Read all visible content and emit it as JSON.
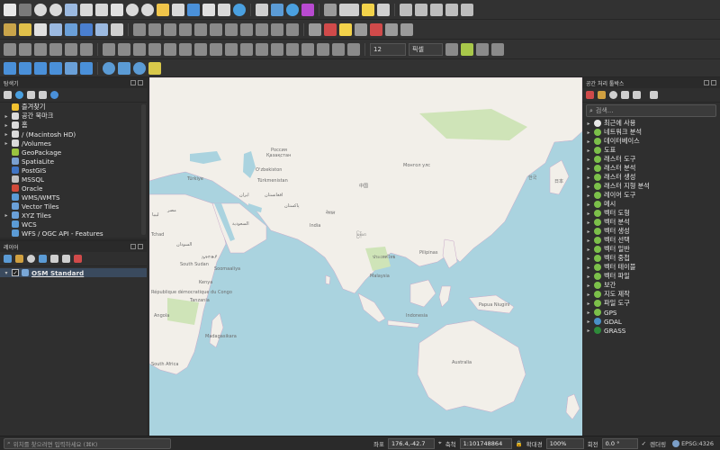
{
  "toolbar": {
    "label_size_value": "12",
    "label_unit_value": "픽셀"
  },
  "browser": {
    "title": "탐색기",
    "items": [
      {
        "label": "즐겨찾기",
        "icon": "star-icon",
        "expandable": false,
        "color": "#f2c230"
      },
      {
        "label": "공간 북마크",
        "icon": "bookmark-icon",
        "expandable": true,
        "color": "#dadada"
      },
      {
        "label": "홈",
        "icon": "folder-icon",
        "expandable": true,
        "color": "#dadada"
      },
      {
        "label": "/ (Macintosh HD)",
        "icon": "folder-icon",
        "expandable": true,
        "color": "#dadada"
      },
      {
        "label": "/Volumes",
        "icon": "folder-icon",
        "expandable": true,
        "color": "#dadada"
      },
      {
        "label": "GeoPackage",
        "icon": "geopackage-icon",
        "expandable": false,
        "color": "#9ac43f"
      },
      {
        "label": "SpatiaLite",
        "icon": "spatialite-icon",
        "expandable": false,
        "color": "#7aa0d0"
      },
      {
        "label": "PostGIS",
        "icon": "postgis-icon",
        "expandable": false,
        "color": "#3f74c4"
      },
      {
        "label": "MSSQL",
        "icon": "mssql-icon",
        "expandable": false,
        "color": "#c0c0c0"
      },
      {
        "label": "Oracle",
        "icon": "oracle-icon",
        "expandable": false,
        "color": "#d04a3a"
      },
      {
        "label": "WMS/WMTS",
        "icon": "wms-icon",
        "expandable": false,
        "color": "#5b9bd5"
      },
      {
        "label": "Vector Tiles",
        "icon": "vector-tiles-icon",
        "expandable": false,
        "color": "#6aa0d8"
      },
      {
        "label": "XYZ Tiles",
        "icon": "xyz-tiles-icon",
        "expandable": true,
        "color": "#6aa0d8"
      },
      {
        "label": "WCS",
        "icon": "wcs-icon",
        "expandable": false,
        "color": "#5b9bd5"
      },
      {
        "label": "WFS / OGC API - Features",
        "icon": "wfs-icon",
        "expandable": false,
        "color": "#5b9bd5"
      }
    ]
  },
  "layers": {
    "title": "레이어",
    "items": [
      {
        "label": "OSM Standard",
        "checked": true
      }
    ]
  },
  "processing": {
    "title": "공간 처리 툴박스",
    "search_placeholder": "검색...",
    "items": [
      {
        "label": "최근에 사용",
        "icon": "clock-icon"
      },
      {
        "label": "네트워크 분석",
        "icon": "qgis-icon"
      },
      {
        "label": "데이터베이스",
        "icon": "qgis-icon"
      },
      {
        "label": "도표",
        "icon": "qgis-icon"
      },
      {
        "label": "래스터 도구",
        "icon": "qgis-icon"
      },
      {
        "label": "래스터 분석",
        "icon": "qgis-icon"
      },
      {
        "label": "래스터 생성",
        "icon": "qgis-icon"
      },
      {
        "label": "래스터 지형 분석",
        "icon": "qgis-icon"
      },
      {
        "label": "레이어 도구",
        "icon": "qgis-icon"
      },
      {
        "label": "메시",
        "icon": "qgis-icon"
      },
      {
        "label": "벡터 도형",
        "icon": "qgis-icon"
      },
      {
        "label": "벡터 분석",
        "icon": "qgis-icon"
      },
      {
        "label": "벡터 생성",
        "icon": "qgis-icon"
      },
      {
        "label": "벡터 선택",
        "icon": "qgis-icon"
      },
      {
        "label": "벡터 일반",
        "icon": "qgis-icon"
      },
      {
        "label": "벡터 중첩",
        "icon": "qgis-icon"
      },
      {
        "label": "벡터 테이블",
        "icon": "qgis-icon"
      },
      {
        "label": "벡터 파일",
        "icon": "qgis-icon"
      },
      {
        "label": "보간",
        "icon": "qgis-icon"
      },
      {
        "label": "지도 제작",
        "icon": "qgis-icon"
      },
      {
        "label": "파일 도구",
        "icon": "qgis-icon"
      },
      {
        "label": "GPS",
        "icon": "qgis-icon"
      },
      {
        "label": "GDAL",
        "icon": "gdal-icon"
      },
      {
        "label": "GRASS",
        "icon": "grass-icon"
      }
    ]
  },
  "map_labels": {
    "china": "中国",
    "turkey": "Türkiye",
    "india": "India",
    "sudan": "السودان",
    "south_sudan": "South Sudan",
    "somalia": "Soomaaliya",
    "drc": "République démocratique du Congo",
    "south_africa": "South Africa",
    "mongolia": "Монгол улс",
    "kazakhstan": "Қазақстан",
    "australia": "Australia",
    "papua": "Papua Niugini",
    "malaysia": "Malaysia",
    "indonesia": "Indonesia",
    "philippines": "Pilipinas",
    "thailand": "ประเทศไทย",
    "iran": "ایران",
    "pakistan": "پاکستان",
    "saudi": "السعودية",
    "egypt": "مصر",
    "libya": "ليبيا",
    "chad": "Tchad",
    "ethiopia": "ኢትዮጵያ",
    "kenya": "Kenya",
    "tanzania": "Tanzania",
    "angola": "Angola",
    "madagascar": "Madagasikara",
    "afghanistan": "افغانستان",
    "uzbekistan": "Oʻzbekiston",
    "myanmar": "မြန်မာ",
    "nepal": "नेपाल",
    "turkmenistan": "Türkmenistan",
    "japan": "日本",
    "korea": "한국",
    "russia": "Россия"
  },
  "statusbar": {
    "locator_placeholder": "위치를 찾으려면 입력하세요 (⌘K)",
    "coord_label": "좌표",
    "coord_value": "176.4,-42.7",
    "scale_label": "축척",
    "scale_value": "1:101748864",
    "magnifier_label": "확대경",
    "magnifier_value": "100%",
    "rotation_label": "회전",
    "rotation_value": "0.0 °",
    "render_label": "렌더링",
    "crs_label": "EPSG:4326"
  }
}
